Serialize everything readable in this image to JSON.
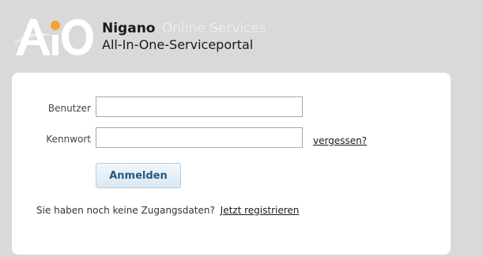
{
  "brand": {
    "logo_text": "AiO",
    "name": "Nigano",
    "name_suffix": "Online Services",
    "subtitle": "All-In-One-Serviceportal"
  },
  "login": {
    "username_label": "Benutzer",
    "username_value": "",
    "password_label": "Kennwort",
    "password_value": "",
    "forgot_link": "vergessen?",
    "submit_label": "Anmelden",
    "no_account_text": "Sie haben noch keine Zugangsdaten?",
    "register_link": "Jetzt registrieren"
  },
  "colors": {
    "background": "#d9d9d9",
    "panel": "#ffffff",
    "logo_orange": "#f2a530",
    "button_text": "#1f5a87"
  }
}
